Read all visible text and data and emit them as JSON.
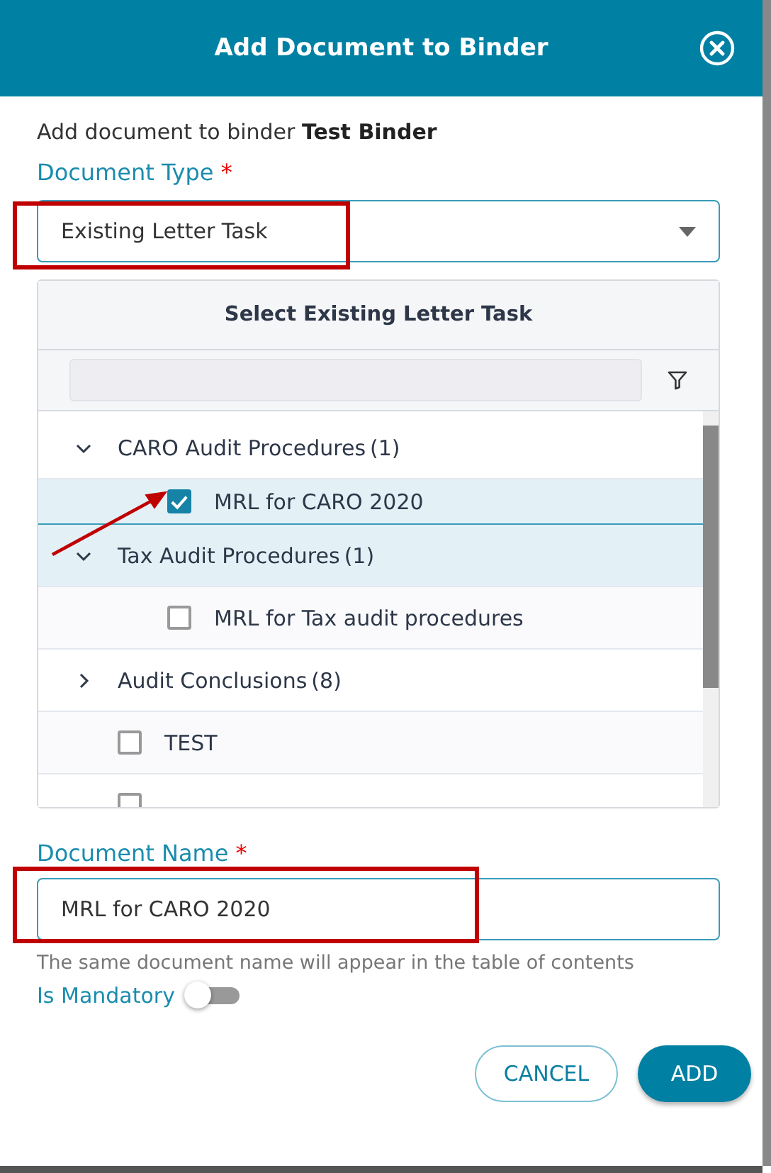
{
  "dialog": {
    "title": "Add Document to Binder"
  },
  "intro": "Add document to binder **Test Binder**",
  "document_type": {
    "label": "Document Type",
    "required_mark": "*",
    "value": "Existing Letter Task"
  },
  "task_picker": {
    "header": "Select Existing Letter Task",
    "rows": [
      {
        "kind": "group",
        "label": "CARO Audit Procedures",
        "count": "(1)",
        "expanded": true,
        "selected": false,
        "children": [
          {
            "kind": "item",
            "label": "MRL for CARO 2020",
            "checked": true,
            "selected": true
          }
        ]
      },
      {
        "kind": "group",
        "label": "Tax Audit Procedures",
        "count": "(1)",
        "expanded": true,
        "selected": true,
        "children": [
          {
            "kind": "item",
            "label": "MRL for Tax audit procedures",
            "checked": false,
            "selected": false
          }
        ]
      },
      {
        "kind": "group",
        "label": "Audit Conclusions",
        "count": "(8)",
        "expanded": false,
        "selected": false
      },
      {
        "kind": "item",
        "label": "TEST",
        "checked": false,
        "selected": false
      },
      {
        "kind": "item",
        "checked": false,
        "selected": false
      }
    ]
  },
  "document_name": {
    "label": "Document Name",
    "required_mark": "*",
    "value": "MRL for CARO 2020",
    "hint": "The same document name will appear in the table of contents"
  },
  "is_mandatory": {
    "label": "Is Mandatory",
    "on": false
  },
  "buttons": [
    {
      "kind": "secondary",
      "label": "CANCEL"
    },
    {
      "kind": "primary",
      "label": "ADD"
    }
  ]
}
